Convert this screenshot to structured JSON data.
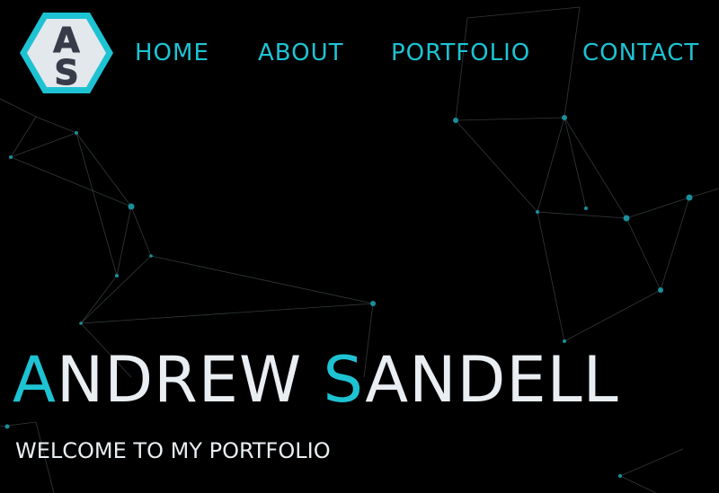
{
  "logo": {
    "letters_top": "A",
    "letters_bottom": "S"
  },
  "nav": {
    "items": [
      {
        "label": "HOME"
      },
      {
        "label": "ABOUT"
      },
      {
        "label": "PORTFOLIO"
      },
      {
        "label": "CONTACT"
      }
    ]
  },
  "hero": {
    "name_first_initial": "A",
    "name_first_rest": "NDREW ",
    "name_last_initial": "S",
    "name_last_rest": "ANDELL",
    "subtitle": "WELCOME TO MY PORTFOLIO"
  },
  "colors": {
    "background": "#000000",
    "accent": "#1ec3d3",
    "text": "#e9eef2",
    "logo_fill": "#e3e8ec",
    "logo_letters": "#3a3b4a"
  }
}
